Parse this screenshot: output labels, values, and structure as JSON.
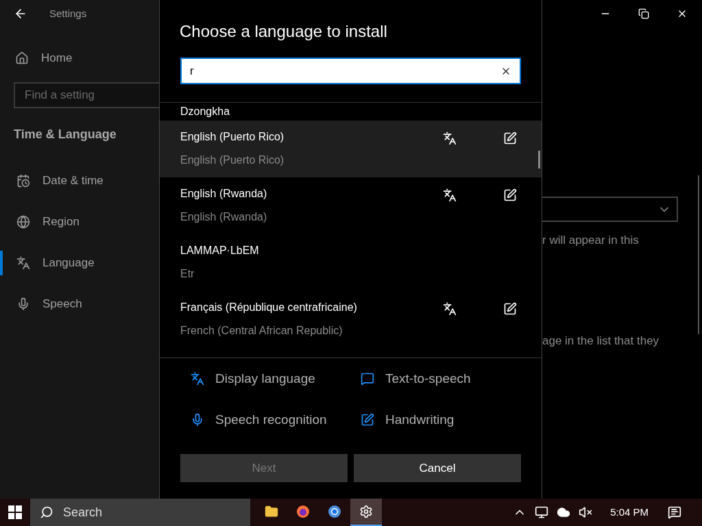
{
  "settings_window": {
    "title": "Settings",
    "sidebar": {
      "home": "Home",
      "search": {
        "placeholder": "Find a setting"
      },
      "section": "Time & Language",
      "items": [
        {
          "label": "Date & time",
          "selected": false
        },
        {
          "label": "Region",
          "selected": false
        },
        {
          "label": "Language",
          "selected": true
        },
        {
          "label": "Speech",
          "selected": false
        }
      ]
    },
    "content": {
      "lines": [
        "r will appear in this",
        "age in the list that they"
      ]
    }
  },
  "dialog": {
    "title": "Choose a language to install",
    "search": {
      "value": "r"
    },
    "languages": [
      {
        "name": "Dzongkha",
        "highlighted": false,
        "display_language": false,
        "handwriting": false
      },
      {
        "name": "English (Puerto Rico)",
        "english_name": "English (Puerto Rico)",
        "highlighted": true,
        "display_language": true,
        "handwriting": true
      },
      {
        "name": "English (Rwanda)",
        "english_name": "English (Rwanda)",
        "highlighted": false,
        "display_language": true,
        "handwriting": true
      },
      {
        "name": "LAMMAP·LbEM",
        "english_name": "Etr",
        "highlighted": false,
        "display_language": false,
        "handwriting": false
      },
      {
        "name": "Français (République centrafricaine)",
        "english_name": "French (Central African Republic)",
        "highlighted": false,
        "display_language": true,
        "handwriting": true
      }
    ],
    "legend": [
      "Display language",
      "Text-to-speech",
      "Speech recognition",
      "Handwriting"
    ],
    "buttons": [
      {
        "label": "Next",
        "disabled": true
      },
      {
        "label": "Cancel",
        "disabled": false
      }
    ]
  },
  "taskbar": {
    "search": {
      "placeholder": "Search"
    },
    "apps": [
      {
        "selected": false
      },
      {
        "selected": false
      },
      {
        "selected": false
      },
      {
        "selected": true
      }
    ],
    "clock": "5:04 PM"
  }
}
